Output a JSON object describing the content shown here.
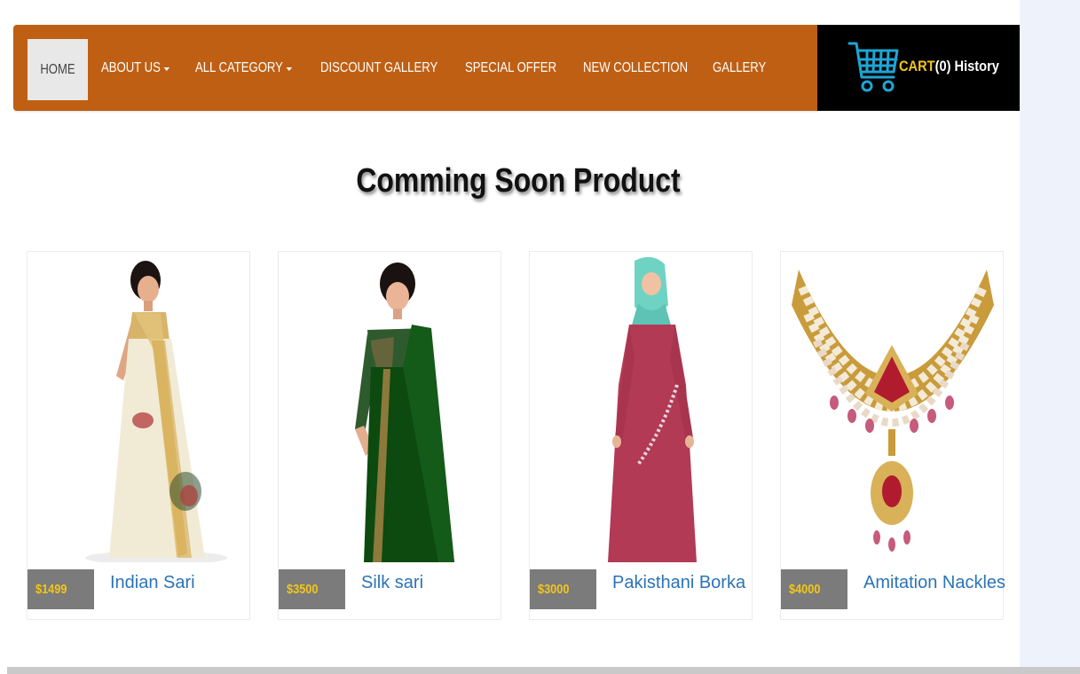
{
  "nav": {
    "home": "HOME",
    "items": [
      {
        "label": "ABOUT US",
        "dropdown": true
      },
      {
        "label": "ALL CATEGORY",
        "dropdown": true
      },
      {
        "label": "DISCOUNT GALLERY",
        "dropdown": false
      },
      {
        "label": "SPECIAL OFFER",
        "dropdown": false
      },
      {
        "label": "NEW COLLECTION",
        "dropdown": false
      },
      {
        "label": "GALLERY",
        "dropdown": false
      }
    ]
  },
  "cart": {
    "label": "CART",
    "count": "(0)",
    "history": "History",
    "icon": "shopping-cart-icon"
  },
  "section": {
    "title": "Comming Soon Product"
  },
  "products": [
    {
      "price": "$1499",
      "name": "Indian Sari",
      "image": "woman-cream-sari-image"
    },
    {
      "price": "$3500",
      "name": "Silk sari",
      "image": "woman-green-silk-sari-image"
    },
    {
      "price": "$3000",
      "name": "Pakisthani Borka",
      "image": "woman-maroon-borka-image"
    },
    {
      "price": "$4000",
      "name": "Amitation Nackles",
      "image": "gold-kundan-necklace-image"
    }
  ],
  "colors": {
    "navbar": "#bf5f14",
    "cart_bg": "#000000",
    "price_bg": "#7b7b7b",
    "price_text": "#f2c51a",
    "link": "#2b73b8",
    "cart_icon": "#1da6d6"
  }
}
